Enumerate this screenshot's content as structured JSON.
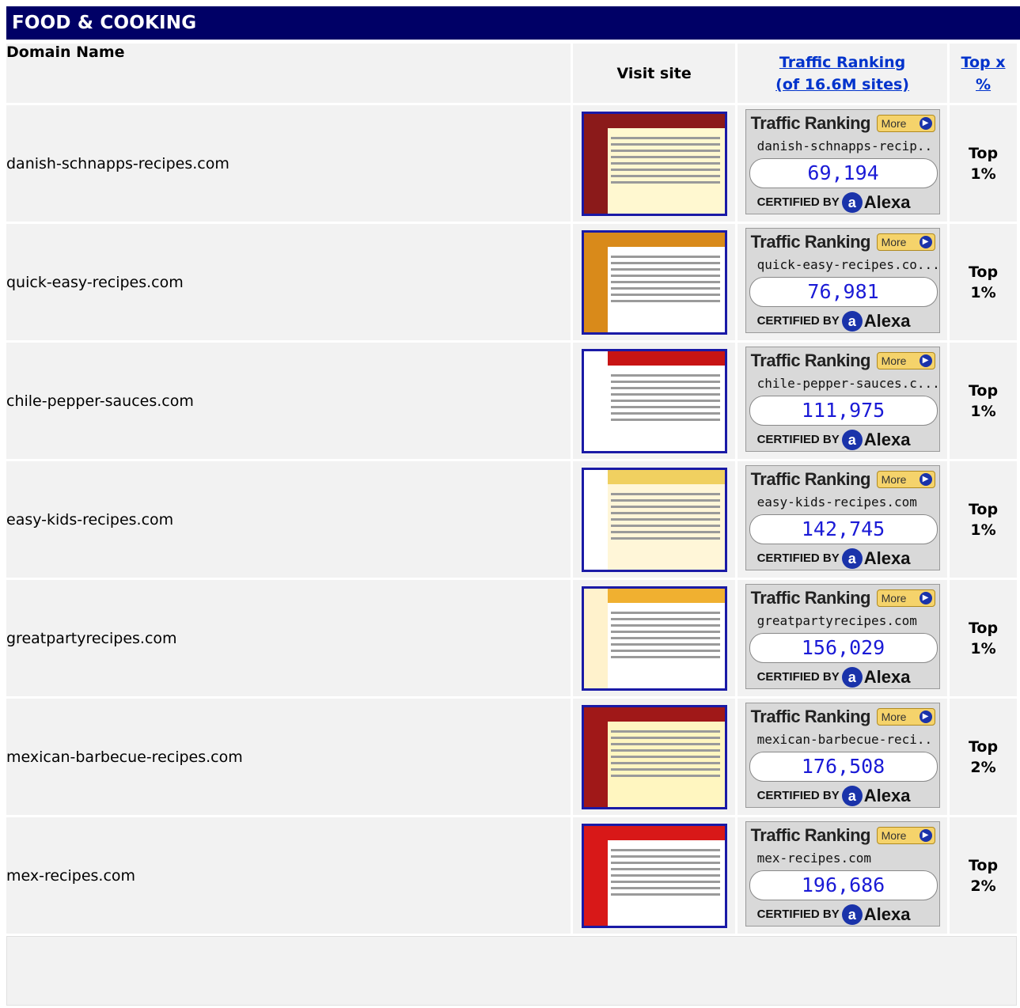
{
  "banner": {
    "title": "FOOD & COOKING"
  },
  "header": {
    "domain_name": "Domain Name",
    "visit_site": "Visit site",
    "traffic_line1": "Traffic Ranking",
    "traffic_line2": "(of 16.6M sites)",
    "top_line1": "Top x",
    "top_line2": "%"
  },
  "badge_labels": {
    "traffic": "Traffic Ranking",
    "more": "More",
    "certified": "CERTIFIED BY",
    "alexa": "Alexa"
  },
  "rows": [
    {
      "domain": "danish-schnapps-recipes.com",
      "badge_domain": "danish-schnapps-recip..",
      "rank": "69,194",
      "top_word": "Top",
      "top_pct": "1%"
    },
    {
      "domain": "quick-easy-recipes.com",
      "badge_domain": "quick-easy-recipes.co...",
      "rank": "76,981",
      "top_word": "Top",
      "top_pct": "1%"
    },
    {
      "domain": "chile-pepper-sauces.com",
      "badge_domain": "chile-pepper-sauces.c...",
      "rank": "111,975",
      "top_word": "Top",
      "top_pct": "1%"
    },
    {
      "domain": "easy-kids-recipes.com",
      "badge_domain": "easy-kids-recipes.com",
      "rank": "142,745",
      "top_word": "Top",
      "top_pct": "1%"
    },
    {
      "domain": "greatpartyrecipes.com",
      "badge_domain": "greatpartyrecipes.com",
      "rank": "156,029",
      "top_word": "Top",
      "top_pct": "1%"
    },
    {
      "domain": "mexican-barbecue-recipes.com",
      "badge_domain": "mexican-barbecue-reci..",
      "rank": "176,508",
      "top_word": "Top",
      "top_pct": "2%"
    },
    {
      "domain": "mex-recipes.com",
      "badge_domain": "mex-recipes.com",
      "rank": "196,686",
      "top_word": "Top",
      "top_pct": "2%"
    }
  ],
  "thumb_colors": [
    {
      "bg": "#fff8d0",
      "side": "#8b1a1a",
      "head": "#8b1a1a"
    },
    {
      "bg": "#ffffff",
      "side": "#d98a1a",
      "head": "#d98a1a"
    },
    {
      "bg": "#ffffff",
      "side": "#ffffff",
      "head": "#c81414"
    },
    {
      "bg": "#fff6d8",
      "side": "#ffffff",
      "head": "#f0d060"
    },
    {
      "bg": "#ffffff",
      "side": "#fff2cc",
      "head": "#f0b030"
    },
    {
      "bg": "#fff6c0",
      "side": "#a01818",
      "head": "#a01818"
    },
    {
      "bg": "#ffffff",
      "side": "#d81818",
      "head": "#d81818"
    }
  ]
}
